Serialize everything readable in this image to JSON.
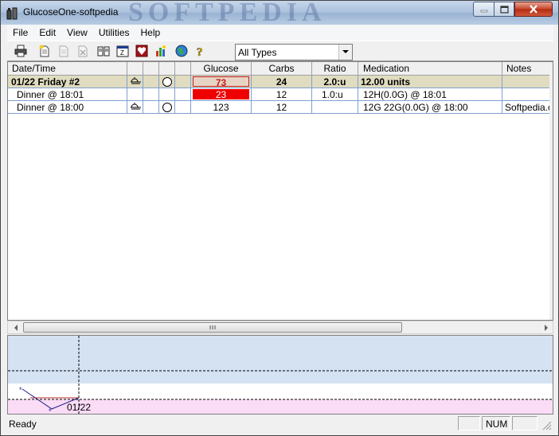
{
  "window": {
    "title": "GlucoseOne-softpedia",
    "watermark": "SOFTPEDIA"
  },
  "menu": [
    "File",
    "Edit",
    "View",
    "Utilities",
    "Help"
  ],
  "toolbar": {
    "icons": [
      "print-icon",
      "new-entry-icon",
      "copy-icon",
      "delete-icon",
      "logbook-icon",
      "calendar-icon",
      "heart-icon",
      "chart-icon",
      "globe-icon",
      "help-icon"
    ],
    "filter": {
      "selected": "All Types"
    }
  },
  "table": {
    "columns": [
      "Date/Time",
      "",
      "",
      "",
      "",
      "Glucose",
      "Carbs",
      "Ratio",
      "Medication",
      "Notes"
    ],
    "rows": [
      {
        "type": "summary",
        "datetime": "01/22 Friday #2",
        "icon1": "meal",
        "icon3": "circle",
        "glucose": "73",
        "carbs": "24",
        "ratio": "2.0:u",
        "medication": "12.00 units",
        "notes": "",
        "glucose_style": "low-border"
      },
      {
        "type": "entry",
        "datetime": "Dinner @ 18:01",
        "icon1": "",
        "icon3": "",
        "glucose": "23",
        "carbs": "12",
        "ratio": "1.0:u",
        "medication": "12H(0.0G) @ 18:01",
        "notes": "",
        "glucose_style": "low-fill"
      },
      {
        "type": "entry",
        "datetime": "Dinner @ 18:00",
        "icon1": "meal",
        "icon3": "circle",
        "glucose": "123",
        "carbs": "12",
        "ratio": "",
        "medication": "12G 22G(0.0G) @ 18:00",
        "notes": "Softpedia.c",
        "glucose_style": "normal"
      }
    ]
  },
  "graph": {
    "date_label": "01/22",
    "colors": {
      "high_band": "#d4e2f2",
      "low_band": "#fadcf6",
      "line": "#1c1c8c",
      "target": "#c0282d"
    }
  },
  "status": {
    "text": "Ready",
    "num": "NUM"
  }
}
